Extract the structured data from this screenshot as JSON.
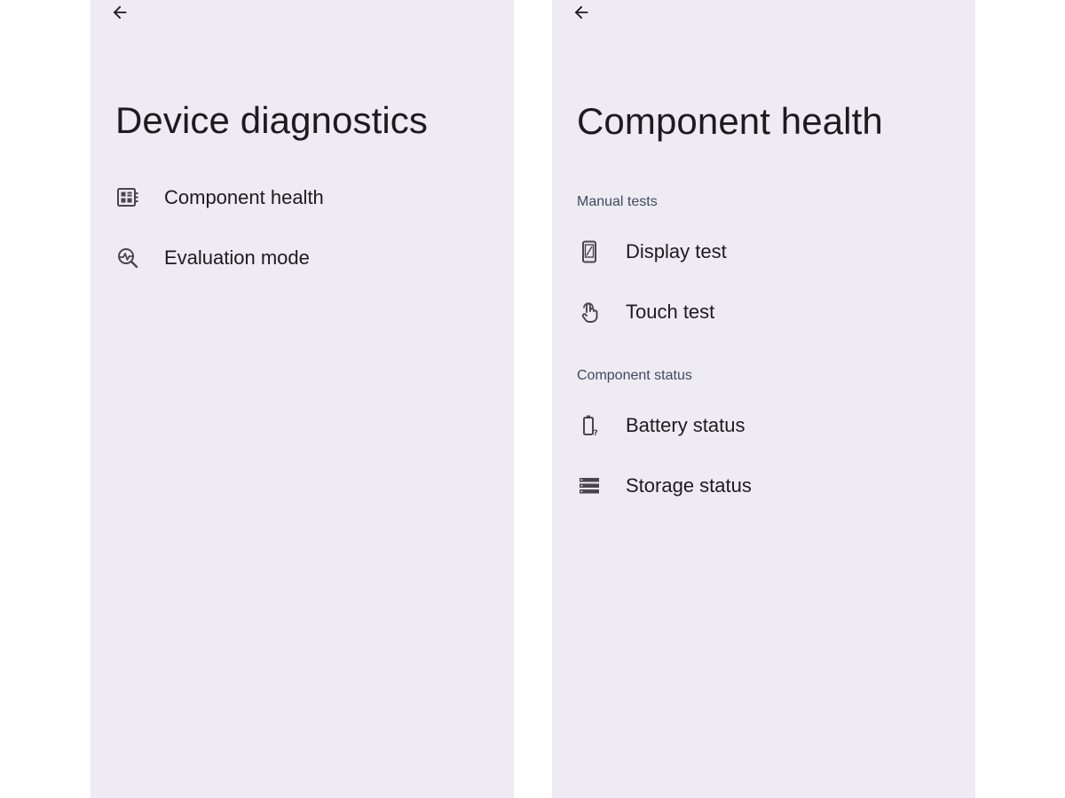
{
  "left_screen": {
    "title": "Device diagnostics",
    "back_icon": "arrow-back-icon",
    "items": [
      {
        "label": "Component health",
        "icon": "component-health-icon"
      },
      {
        "label": "Evaluation mode",
        "icon": "evaluation-mode-icon"
      }
    ]
  },
  "right_screen": {
    "title": "Component health",
    "back_icon": "arrow-back-icon",
    "sections": [
      {
        "header": "Manual tests",
        "items": [
          {
            "label": "Display test",
            "icon": "display-test-icon"
          },
          {
            "label": "Touch test",
            "icon": "touch-test-icon"
          }
        ]
      },
      {
        "header": "Component status",
        "items": [
          {
            "label": "Battery status",
            "icon": "battery-unknown-icon"
          },
          {
            "label": "Storage status",
            "icon": "storage-icon"
          }
        ]
      }
    ]
  },
  "colors": {
    "screen_background": "#eeebf2",
    "text_primary": "#1d1b20",
    "section_header": "#3f4a62",
    "icon": "#49454f"
  }
}
